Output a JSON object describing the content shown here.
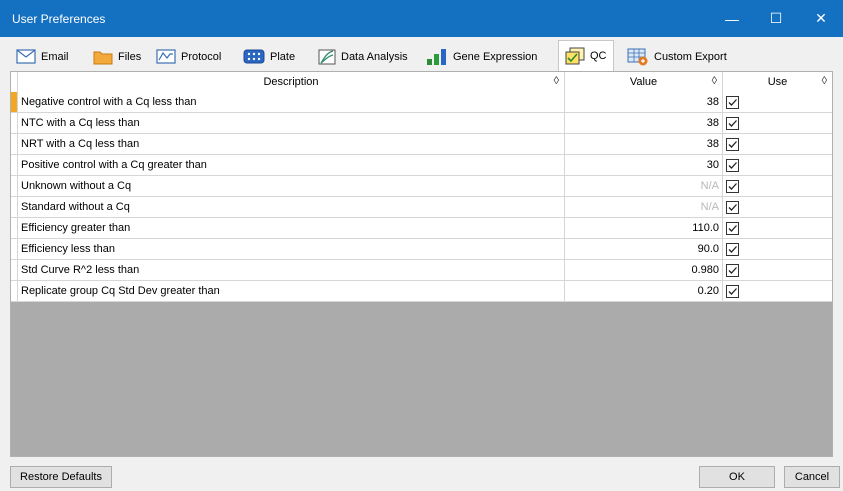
{
  "window": {
    "title": "User Preferences",
    "minimize": "—",
    "maximize": "☐",
    "close": "✕"
  },
  "tabs": [
    {
      "label": "Email"
    },
    {
      "label": "Files"
    },
    {
      "label": "Protocol"
    },
    {
      "label": "Plate"
    },
    {
      "label": "Data Analysis"
    },
    {
      "label": "Gene Expression"
    },
    {
      "label": "QC"
    },
    {
      "label": "Custom Export"
    }
  ],
  "active_tab": "QC",
  "grid": {
    "headers": {
      "description": "Description",
      "value": "Value",
      "use": "Use",
      "sort_glyph": "◊"
    },
    "rows": [
      {
        "description": "Negative control with a Cq less than",
        "value": "38",
        "use": true
      },
      {
        "description": "NTC with a Cq less than",
        "value": "38",
        "use": true
      },
      {
        "description": "NRT with a Cq less than",
        "value": "38",
        "use": true
      },
      {
        "description": "Positive control with a Cq greater than",
        "value": "30",
        "use": true
      },
      {
        "description": "Unknown without a Cq",
        "value": "N/A",
        "use": true
      },
      {
        "description": "Standard without a Cq",
        "value": "N/A",
        "use": true
      },
      {
        "description": "Efficiency greater than",
        "value": "110.0",
        "use": true
      },
      {
        "description": "Efficiency less than",
        "value": "90.0",
        "use": true
      },
      {
        "description": "Std Curve R^2 less than",
        "value": "0.980",
        "use": true
      },
      {
        "description": "Replicate group Cq Std Dev greater than",
        "value": "0.20",
        "use": true
      }
    ]
  },
  "buttons": {
    "restore_defaults": "Restore Defaults",
    "ok": "OK",
    "cancel": "Cancel"
  },
  "colors": {
    "titlebar": "#1470c0",
    "row_indicator": "#f5a623",
    "empty_grid": "#ababab"
  }
}
